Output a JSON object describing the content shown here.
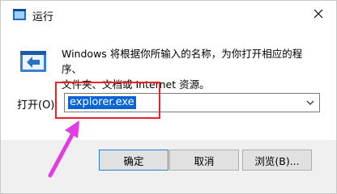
{
  "window": {
    "title": "运行",
    "app_icon": "run-icon"
  },
  "content": {
    "description_line1": "Windows 将根据你所输入的名称，为你打开相应的程序、",
    "description_line2": "文件夹、文档或 Internet 资源。",
    "open_label": "打开(O):",
    "open_value": "explorer.exe"
  },
  "buttons": {
    "ok": "确定",
    "cancel": "取消",
    "browse": "浏览(B)..."
  },
  "colors": {
    "selection": "#0a64d6",
    "highlight_box": "#e8242b",
    "arrow": "#e23ce6"
  }
}
